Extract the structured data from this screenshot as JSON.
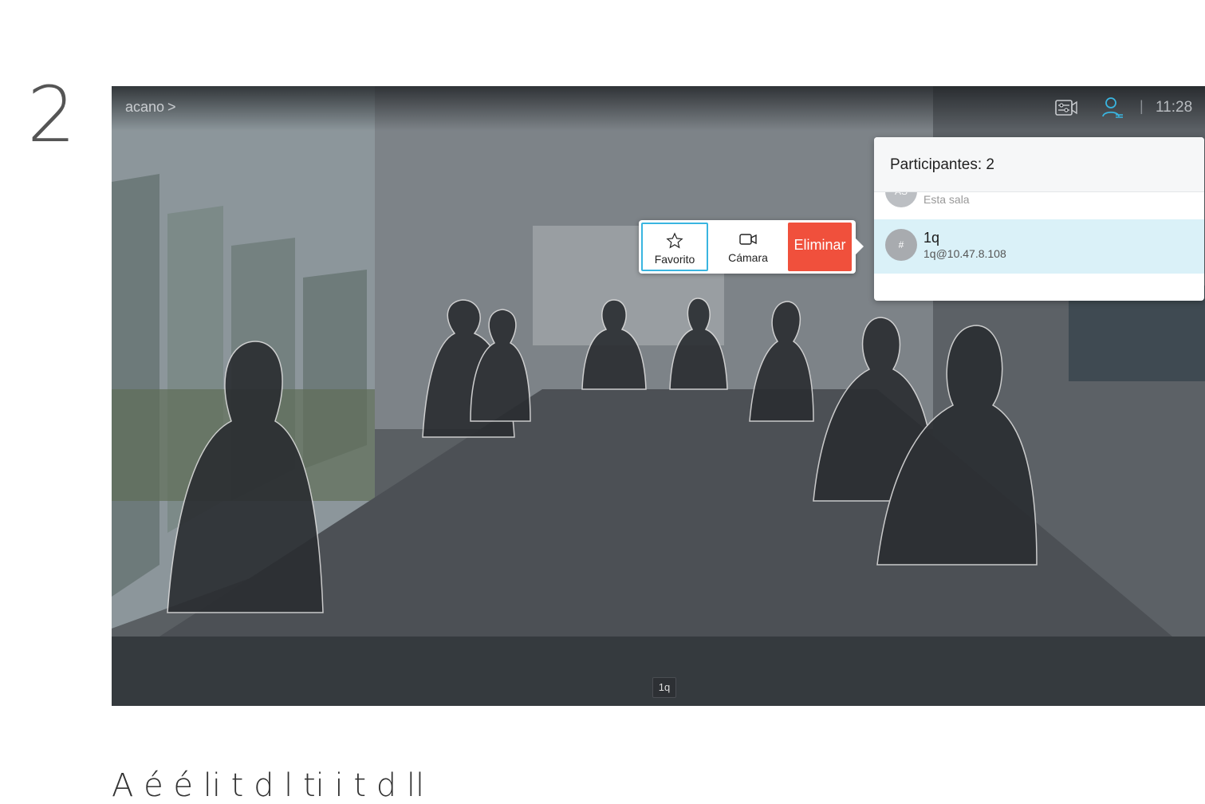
{
  "step_number": "2",
  "call": {
    "name": "acano",
    "chevron": ">"
  },
  "status": {
    "separator": "|",
    "time": "11:28"
  },
  "icons": {
    "camera_controls": "camera-controls-icon",
    "participants": "participants-icon"
  },
  "panel": {
    "title": "Participantes: 2",
    "participants": [
      {
        "initials": "AS",
        "name": "",
        "subtitle": "Esta sala"
      },
      {
        "initials": "#",
        "name": "1q",
        "subtitle": "1q@10.47.8.108"
      }
    ]
  },
  "actions": {
    "favorite": "Favorito",
    "camera": "Cámara",
    "remove": "Eliminar"
  },
  "name_tag": "1q",
  "caption": "A       é          é                 li   t     d   l              ti i      t                d   ll",
  "colors": {
    "accent": "#39b5e0",
    "remove": "#f0503c",
    "selected_row": "#daf1f8"
  }
}
